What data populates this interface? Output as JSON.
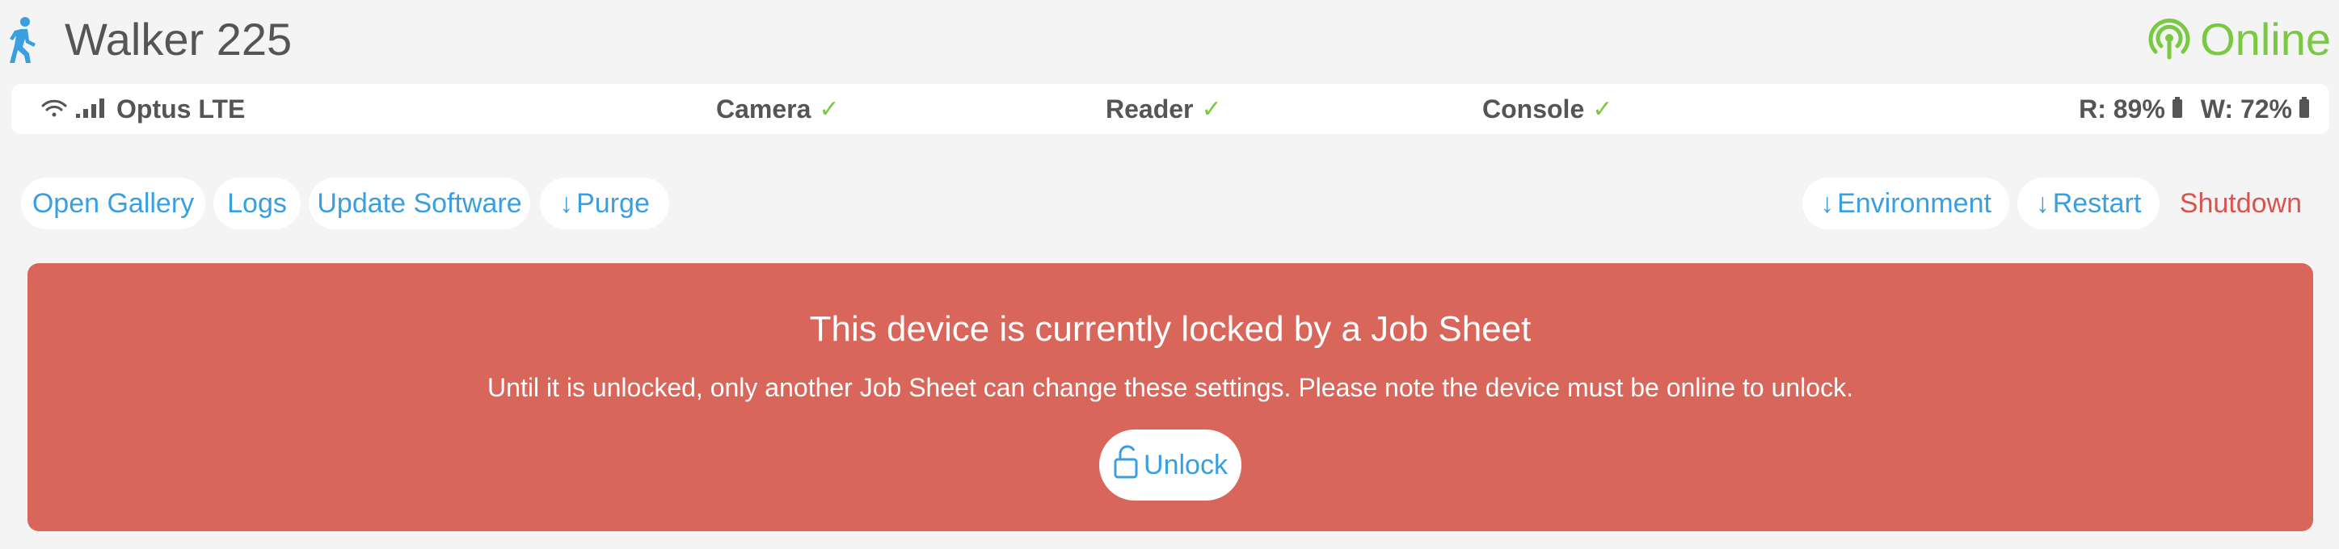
{
  "header": {
    "title": "Walker 225",
    "status": "Online",
    "walker_icon": "walker-icon",
    "online_icon": "signal-broadcast-icon",
    "online_color": "#7ac943"
  },
  "status_bar": {
    "network": "Optus LTE",
    "camera": "Camera",
    "reader": "Reader",
    "console": "Console",
    "check_glyph": "✓",
    "battery_r": "R: 89%",
    "battery_w": "W: 72%"
  },
  "toolbar": {
    "open_gallery": "Open Gallery",
    "logs": "Logs",
    "update_software": "Update Software",
    "purge": "Purge",
    "environment": "Environment",
    "restart": "Restart",
    "shutdown": "Shutdown",
    "download_arrow": "↓",
    "link_color": "#3a9fe0",
    "danger_color": "#d9534f"
  },
  "lock_panel": {
    "title": "This device is currently locked by a Job Sheet",
    "message": "Until it is unlocked, only another Job Sheet can change these settings. Please note the device must be online to unlock.",
    "unlock_label": "Unlock",
    "unlock_icon": "unlock-icon",
    "background": "#d9665a"
  }
}
